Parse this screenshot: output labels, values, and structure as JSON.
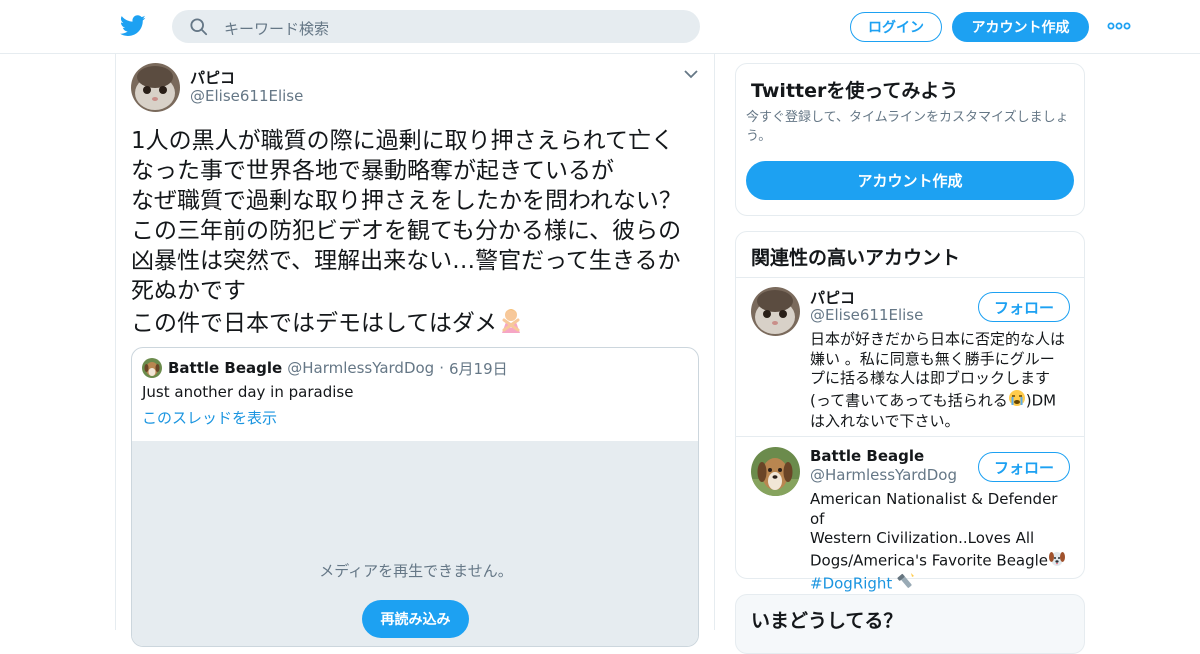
{
  "header": {
    "search_placeholder": "キーワード検索",
    "login_label": "ログイン",
    "signup_label": "アカウント作成"
  },
  "tweet": {
    "author_name": "パピコ",
    "author_handle": "@Elise611Elise",
    "text": "1人の黒人が職質の際に過剰に取り押さえられて亡く\nなった事で世界各地で暴動略奪が起きているが\nなぜ職質で過剰な取り押さえをしたかを問われない？\nこの三年前の防犯ビデオを観ても分かる様に、彼らの\n凶暴性は突然で、理解出来ない…警官だって生きるか\n死ぬかです\nこの件で日本ではデモはしてはダメ",
    "emoji_name": "person-gesturing-no-emoji",
    "quote": {
      "author_name": "Battle Beagle",
      "author_handle": "@HarmlessYardDog",
      "separator": "·",
      "date": "6月19日",
      "text": "Just another day in paradise",
      "thread_link": "このスレッドを表示",
      "media_message": "メディアを再生できません。",
      "reload_label": "再読み込み"
    }
  },
  "sidebar": {
    "signup_card": {
      "title": "Twitterを使ってみよう",
      "description": "今すぐ登録して、タイムラインをカスタマイズしましょう。",
      "button_label": "アカウント作成"
    },
    "related_card": {
      "title": "関連性の高いアカウント",
      "follow_label": "フォロー",
      "accounts": [
        {
          "name": "パピコ",
          "handle": "@Elise611Elise",
          "bio": "日本が好きだから日本に否定的な人は\n嫌い 。私に同意も無く勝手にグルー\nプに括る様な人は即ブロックします\n(って書いてあっても括られる",
          "bio_after_emoji": ")DM\nは入れないで下さい。"
        },
        {
          "name": "Battle Beagle",
          "handle": "@HarmlessYardDog",
          "bio": "American Nationalist & Defender of\nWestern Civilization..Loves All\nDogs/America's Favorite Beagle",
          "hashtag": "#DogRight"
        }
      ]
    },
    "trends_card": {
      "title": "いまどうしてる？"
    }
  },
  "colors": {
    "brand": "#1da1f2",
    "link": "#1b95e0",
    "secondary_text": "#657786",
    "border": "#e6ecf0"
  }
}
